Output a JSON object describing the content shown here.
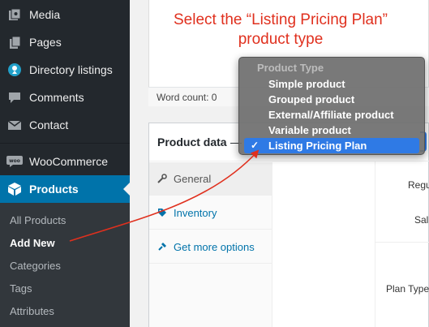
{
  "sidebar": {
    "items": [
      {
        "label": "Media",
        "icon": "media-icon"
      },
      {
        "label": "Pages",
        "icon": "pages-icon"
      },
      {
        "label": "Directory listings",
        "icon": "directory-icon"
      },
      {
        "label": "Comments",
        "icon": "comments-icon"
      },
      {
        "label": "Contact",
        "icon": "envelope-icon"
      },
      {
        "label": "WooCommerce",
        "icon": "woocommerce-icon"
      },
      {
        "label": "Products",
        "icon": "box-icon"
      }
    ],
    "submenu": [
      "All Products",
      "Add New",
      "Categories",
      "Tags",
      "Attributes"
    ]
  },
  "annotation": {
    "line1": "Select the “Listing Pricing Plan”",
    "line2": "product type"
  },
  "editor": {
    "word_count": "Word count: 0"
  },
  "product_data": {
    "title": "Product data",
    "dash": "—",
    "tabs": [
      "General",
      "Inventory",
      "Get more options"
    ],
    "field_labels": [
      "Regu",
      "Sal",
      "Plan Type"
    ]
  },
  "dropdown": {
    "group_label": "Product Type",
    "options": [
      "Simple product",
      "Grouped product",
      "External/Affiliate product",
      "Variable product",
      "Listing Pricing Plan"
    ],
    "selected": "Listing Pricing Plan",
    "check": "✓"
  },
  "colors": {
    "annotation": "#e0301e",
    "accent": "#0073aa",
    "selection": "#2f7ae5"
  }
}
